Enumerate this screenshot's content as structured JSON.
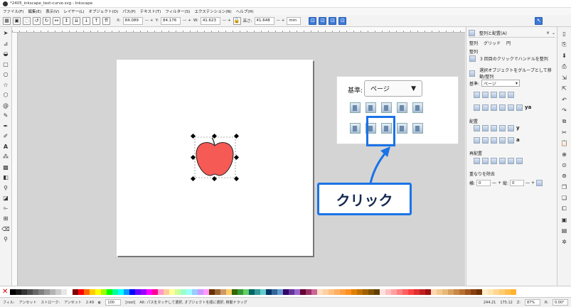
{
  "window": {
    "title": "*2405_inkscape_text-curve.svg - Inkscape"
  },
  "menu": [
    "ファイル(F)",
    "編集(E)",
    "表示(V)",
    "レイヤー(L)",
    "オブジェクト(O)",
    "パス(P)",
    "テキスト(T)",
    "フィルター(S)",
    "エクステンション(N)",
    "ヘルプ(H)"
  ],
  "toolbar": {
    "x_label": "X:",
    "x_value": "84.089",
    "y_label": "Y:",
    "y_value": "84.176",
    "w_label": "W:",
    "w_value": "41.623",
    "h_label": "高さ:",
    "h_value": "41.648",
    "unit": "mm"
  },
  "popup": {
    "ref_label": "基準:",
    "ref_value": "ページ"
  },
  "callout": {
    "text": "クリック"
  },
  "panel": {
    "title": "整列と配置(A)",
    "tab_align": "整列",
    "tab_grid": "グリッド",
    "tab_circle": "円",
    "section_align": "整列",
    "opt1": "3 回目のクリックでハンドルを整列",
    "opt2": "選択オブジェクトをグループとして移動/整列",
    "ref_label": "基準:",
    "ref_value": "ページ",
    "section_distribute": "配置",
    "section_rearrange": "再配置",
    "section_overlap": "重なりを除去",
    "hgap_label": "横:",
    "hgap_value": "0",
    "vgap_label": "縦:",
    "vgap_value": "0"
  },
  "status": {
    "fill_label": "フィル:",
    "fill_value": "アンセット",
    "stroke_label": "ストローク:",
    "stroke_value": "アンセット",
    "stroke_width": "2.49",
    "opacity": "100",
    "layer": "[root]",
    "message": "Alt: パスをタッチして選択, オブジェクトを順に選択, 移動ドラッグ",
    "x_coord": "244.21",
    "y_coord": "175.12",
    "zoom_label": "Z:",
    "zoom": "87%",
    "rotate_label": "R:",
    "rotate": "0.00°"
  }
}
